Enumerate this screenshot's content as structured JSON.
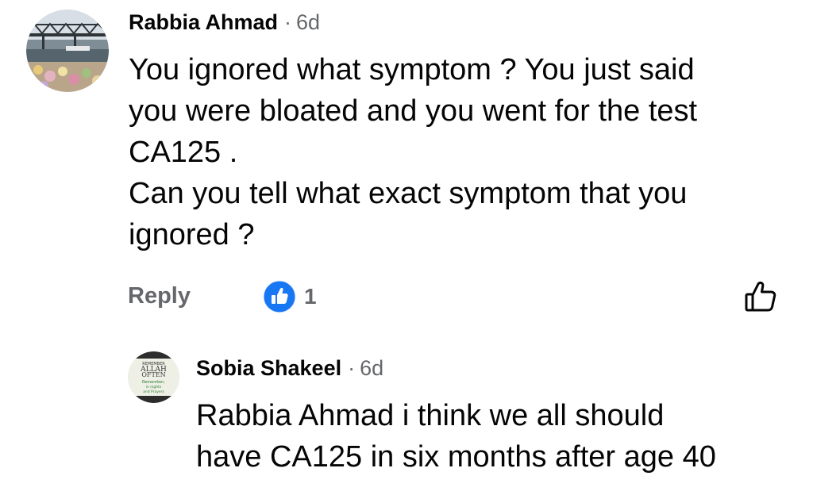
{
  "comments": [
    {
      "author": "Rabbia Ahmad",
      "separator": "·",
      "time": "6d",
      "lines": [
        "You ignored what symptom ? You just said",
        "you were bloated and you went for the test",
        "CA125 .",
        "Can you tell what exact symptom that you",
        "ignored ?"
      ],
      "reply_label": "Reply",
      "reaction_count": "1",
      "avatar_icon": "bridge-photo-avatar"
    }
  ],
  "replies": [
    {
      "author": "Sobia Shakeel",
      "separator": "·",
      "time": "6d",
      "lines": [
        "Rabbia Ahmad i think we all should",
        "have CA125 in six months after age 40"
      ],
      "avatar_icon": "text-badge-avatar",
      "avatar_text": [
        "REMEMBER",
        "ALLAH",
        "OFTEN",
        "Remember,",
        "in",
        "nights",
        "and",
        "Prayers"
      ]
    }
  ],
  "colors": {
    "text": "#050505",
    "secondary": "#65676b",
    "like_blue": "#1877f2"
  }
}
